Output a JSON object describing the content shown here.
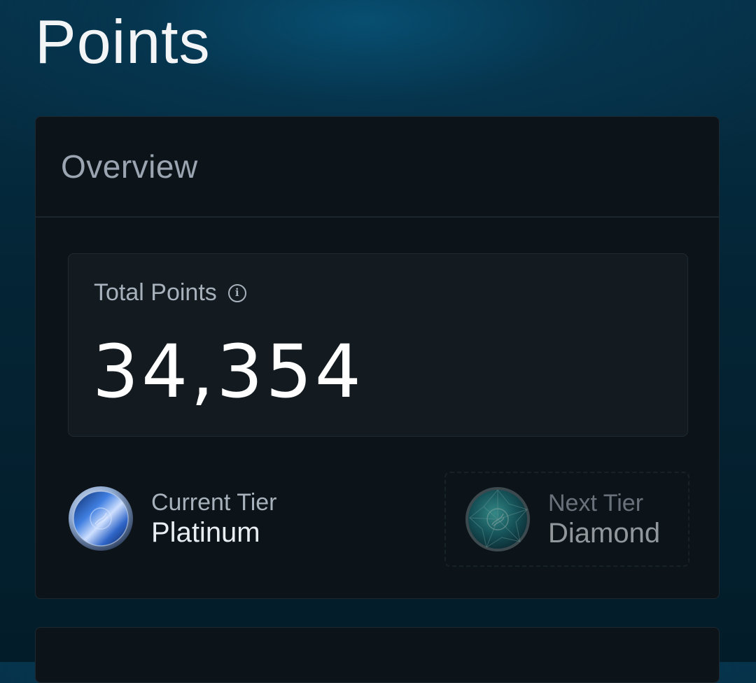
{
  "page": {
    "title": "Points"
  },
  "overview": {
    "title": "Overview",
    "total_points": {
      "label": "Total Points",
      "info_icon": "info-circle-icon",
      "value": "34,354"
    },
    "current_tier": {
      "caption": "Current Tier",
      "name": "Platinum",
      "icon": "platinum-coin-icon"
    },
    "next_tier": {
      "caption": "Next Tier",
      "name": "Diamond",
      "icon": "diamond-gem-icon"
    }
  },
  "colors": {
    "background": "#042536",
    "card": "#0d1419",
    "accent_platinum": "#2a66c8",
    "accent_diamond": "#1e8a8a"
  }
}
